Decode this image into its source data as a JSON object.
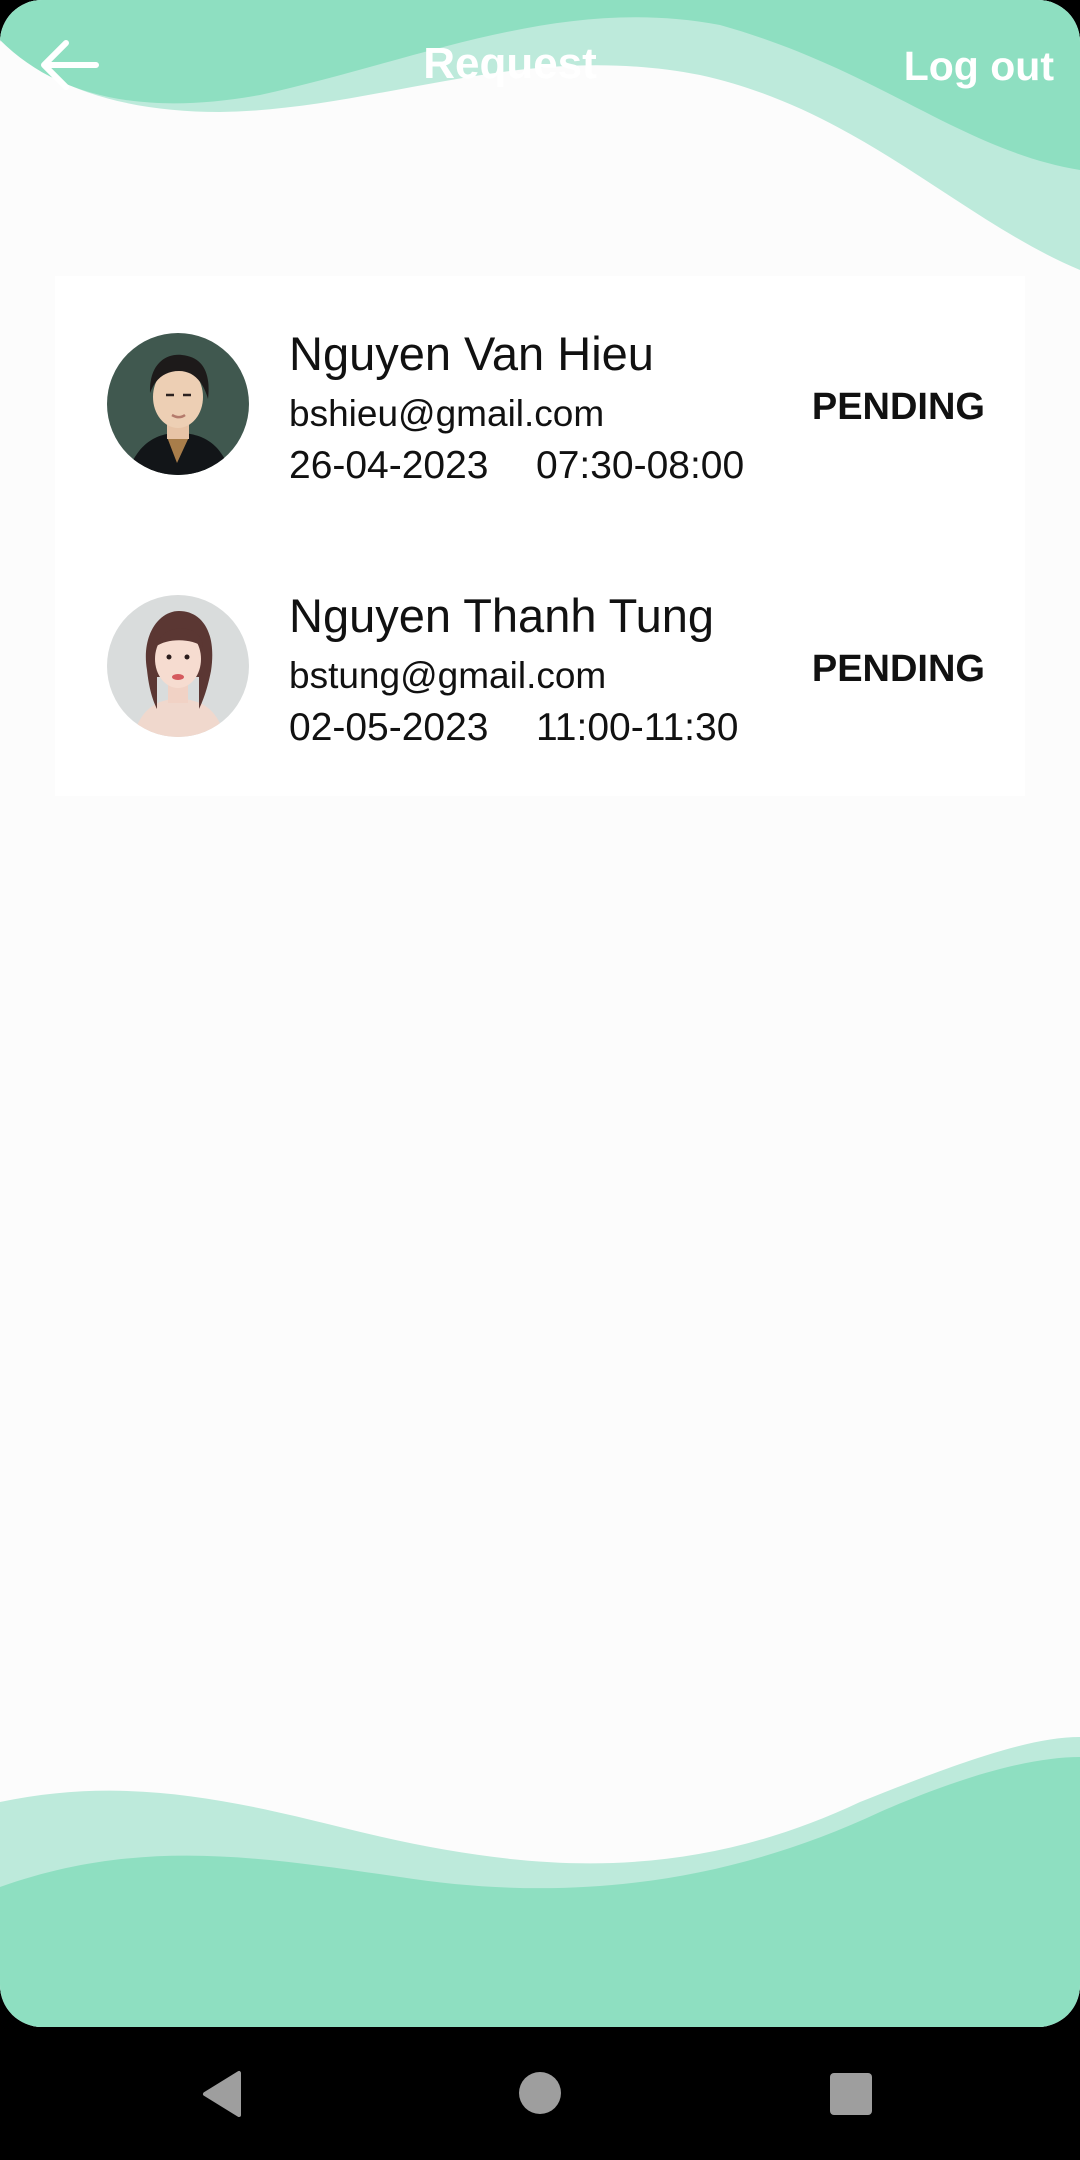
{
  "header": {
    "title": "Request",
    "logout_label": "Log out"
  },
  "theme": {
    "accent": "#8edfc1",
    "accent_light": "#bdeadb",
    "background": "#fcfcfc",
    "text": "#111111"
  },
  "requests": [
    {
      "name": "Nguyen Van Hieu",
      "email": "bshieu@gmail.com",
      "date": "26-04-2023",
      "time": "07:30-08:00",
      "status": "PENDING"
    },
    {
      "name": "Nguyen Thanh Tung",
      "email": "bstung@gmail.com",
      "date": "02-05-2023",
      "time": "11:00-11:30",
      "status": "PENDING"
    }
  ],
  "nav": {
    "back_icon": "triangle-back-icon",
    "home_icon": "circle-home-icon",
    "recents_icon": "square-recents-icon"
  }
}
